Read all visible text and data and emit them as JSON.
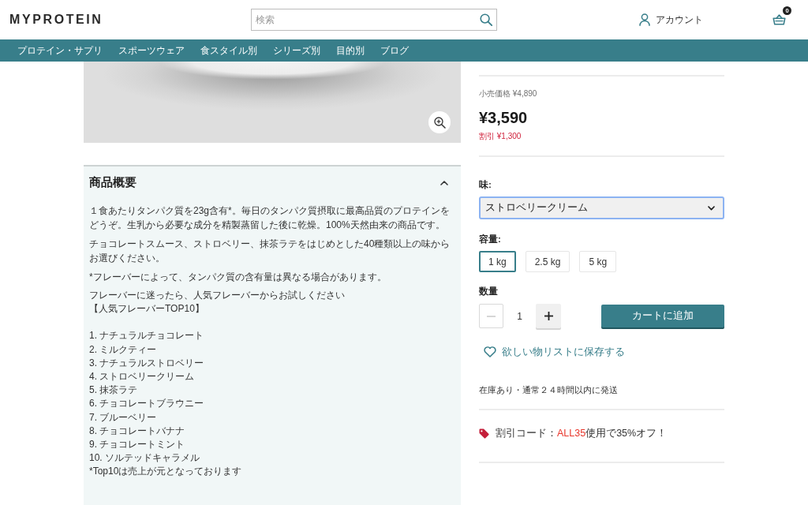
{
  "header": {
    "logo": "MYPROTEIN",
    "search": {
      "placeholder": "検索"
    },
    "account": "アカウント",
    "cart_count": "0"
  },
  "nav": [
    "プロテイン・サプリ",
    "スポーツウェア",
    "食スタイル別",
    "シリーズ別",
    "目的別",
    "ブログ"
  ],
  "description": {
    "title": "商品概要",
    "expanded": true,
    "paragraphs": [
      "１食あたりタンパク質を23g含有*。毎日のタンパク質摂取に最高品質のプロテインをどうぞ。生乳から必要な成分を精製蒸留した後に乾燥。100%天然由来の商品です。",
      "チョコレートスムース、ストロベリー、抹茶ラテをはじめとした40種類以上の味からお選びください。",
      "*フレーバーによって、タンパク質の含有量は異なる場合があります。"
    ],
    "lead_lines": [
      "フレーバーに迷ったら、人気フレーバーからお試しください",
      "【人気フレーバーTOP10】"
    ],
    "ranking": [
      "1. ナチュラルチョコレート",
      "2. ミルクティー",
      "3. ナチュラルストロベリー",
      "4. ストロベリークリーム",
      "5. 抹茶ラテ",
      "6. チョコレートブラウニー",
      "7. ブルーベリー",
      "8. チョコレートバナナ",
      "9. チョコレートミント",
      "10. ソルテッドキャラメル"
    ],
    "note": "*Top10は売上が元となっております"
  },
  "pricing": {
    "rrp": "小売価格 ¥4,890",
    "price": "¥3,590",
    "saving": "割引 ¥1,300"
  },
  "flavour": {
    "label": "味:",
    "value": "ストロベリークリーム",
    "focused": true
  },
  "size": {
    "label": "容量:",
    "options": [
      {
        "label": "1 kg",
        "selected": true
      },
      {
        "label": "2.5 kg",
        "selected": false
      },
      {
        "label": "5 kg",
        "selected": false
      }
    ]
  },
  "quantity": {
    "label": "数量",
    "value": "1",
    "decrease_disabled": true
  },
  "add_to_cart": "カートに追加",
  "wishlist": "欲しい物リストに保存する",
  "stock": "在庫あり・通常２４時間以内に発送",
  "promo": {
    "prefix": "割引コード：",
    "code": "ALL35",
    "suffix": "使用で35%オフ！"
  }
}
